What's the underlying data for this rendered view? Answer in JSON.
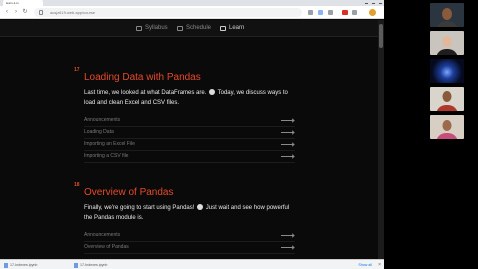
{
  "browser": {
    "tab_title": "learn-1-in",
    "url": "acsjz619.web.app/course",
    "nav_icons": [
      "back-icon",
      "forward-icon",
      "reload-icon"
    ]
  },
  "site_nav": {
    "items": [
      {
        "label": "Syllabus",
        "icon": "book-icon",
        "active": false
      },
      {
        "label": "Schedule",
        "icon": "calendar-icon",
        "active": false
      },
      {
        "label": "Learn",
        "icon": "laptop-icon",
        "active": true
      }
    ]
  },
  "lessons": [
    {
      "number": "17",
      "title": "Loading Data with Pandas",
      "description_before": "Last time, we looked at what DataFrames are.",
      "description_after": "Today, we discuss ways to load and clean Excel and CSV files.",
      "topics": [
        "Announcements",
        "Loading Data",
        "Importing an Excel File",
        "Importing a CSV file"
      ]
    },
    {
      "number": "18",
      "title": "Overview of Pandas",
      "description_before": "Finally, we're going to start using Pandas!",
      "description_after": "Just wait and see how powerful the Pandas module is.",
      "topics": [
        "Announcements",
        "Overview of Pandas"
      ]
    }
  ],
  "downloads": {
    "items": [
      "17-Indexes.ipynb",
      "17-Indexes.ipynb"
    ],
    "show_all": "Show all"
  },
  "colors": {
    "accent": "#e8482a",
    "page_bg": "#0a0a0a",
    "text": "#e9e9e9",
    "muted": "#7a7a7a"
  }
}
